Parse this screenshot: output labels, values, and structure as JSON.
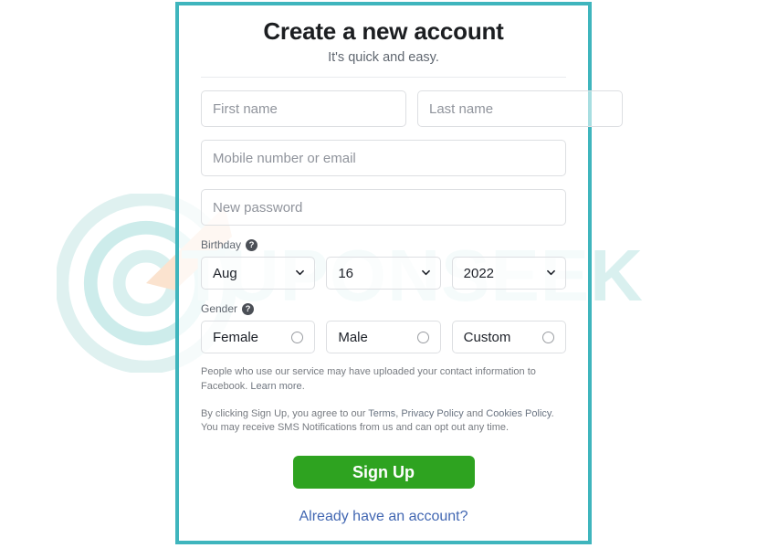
{
  "watermark": {
    "text": "TUPONSEEK",
    "logo_icon": "target-circles-arrow-icon",
    "color": "#d9f0ef",
    "accent_color": "#fbe3cf"
  },
  "card": {
    "border_color": "#3fb5bd",
    "header": {
      "title": "Create a new account",
      "subtitle": "It's quick and easy."
    },
    "fields": {
      "first_name": {
        "placeholder": "First name",
        "value": ""
      },
      "last_name": {
        "placeholder": "Last name",
        "value": ""
      },
      "contact": {
        "placeholder": "Mobile number or email",
        "value": ""
      },
      "password": {
        "placeholder": "New password",
        "value": ""
      }
    },
    "birthday": {
      "label": "Birthday",
      "help_icon": "question-mark-icon",
      "month": {
        "value": "Aug",
        "chevron": "chevron-down-icon"
      },
      "day": {
        "value": "16",
        "chevron": "chevron-down-icon"
      },
      "year": {
        "value": "2022",
        "chevron": "chevron-down-icon"
      }
    },
    "gender": {
      "label": "Gender",
      "help_icon": "question-mark-icon",
      "options": [
        {
          "label": "Female",
          "selected": false
        },
        {
          "label": "Male",
          "selected": false
        },
        {
          "label": "Custom",
          "selected": false
        }
      ]
    },
    "legal": {
      "contact_info_text_before": "People who use our service may have uploaded your contact information to Facebook. ",
      "learn_more_label": "Learn more",
      "contact_info_text_after": ".",
      "terms_prefix": "By clicking Sign Up, you agree to our ",
      "terms_label": "Terms",
      "terms_sep_1": ", ",
      "privacy_label": "Privacy Policy",
      "terms_sep_2": " and ",
      "cookies_label": "Cookies Policy",
      "terms_suffix": ". You may receive SMS Notifications from us and can opt out any time."
    },
    "submit": {
      "label": "Sign Up",
      "color": "#2ea320"
    },
    "login_link": {
      "label": "Already have an account?",
      "color": "#4267b2"
    }
  }
}
